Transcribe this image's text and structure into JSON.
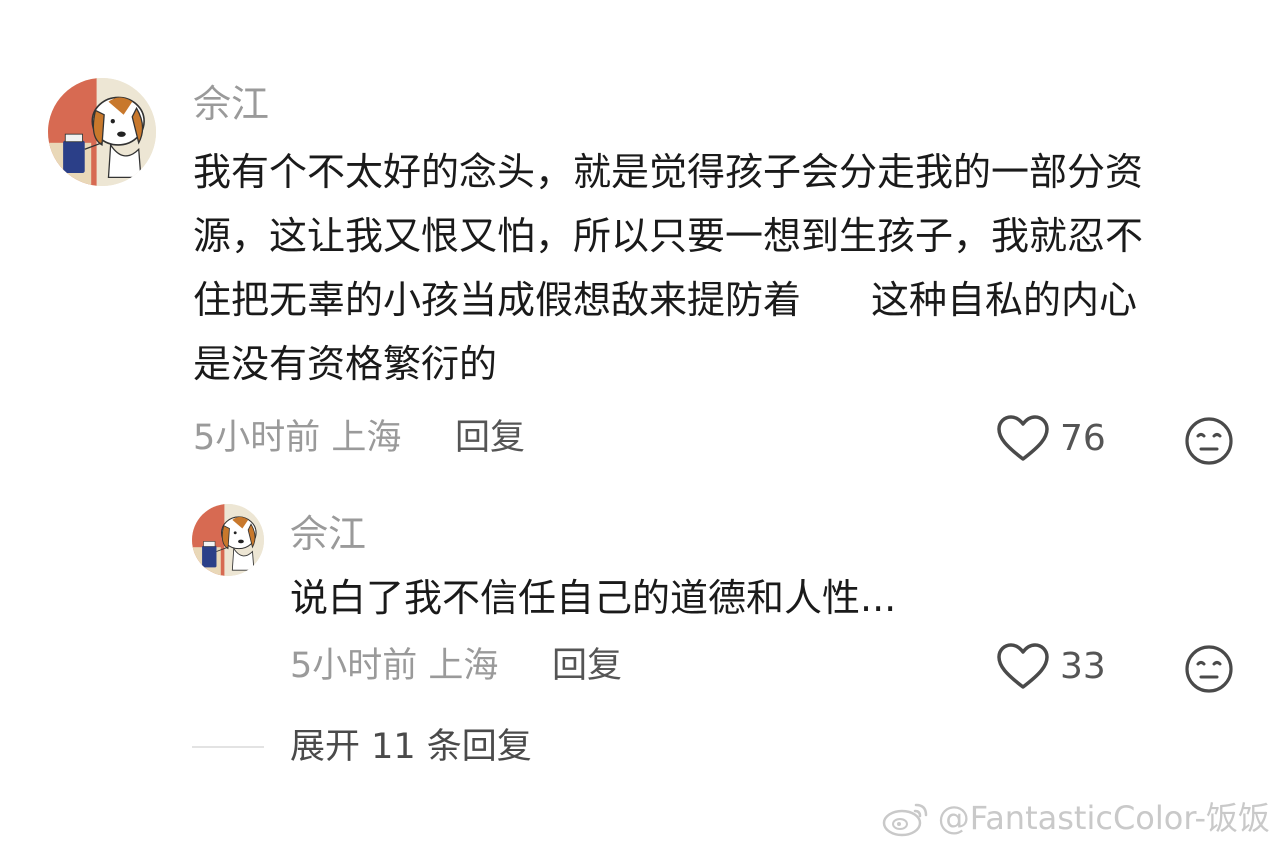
{
  "comment": {
    "username": "佘江",
    "text_lines": [
      "我有个不太好的念头，就是觉得孩子会分走我的一部分资",
      "源，这让我又恨又怕，所以只要一想到生孩子，我就忍不",
      "住把无辜的小孩当成假想敌来提防着",
      "这种自私的内心",
      "是没有资格繁衍的"
    ],
    "time": "5小时前",
    "location": "上海",
    "reply_label": "回复",
    "likes": "76"
  },
  "reply": {
    "username": "佘江",
    "text": "说白了我不信任自己的道德和人性...",
    "time": "5小时前",
    "location": "上海",
    "reply_label": "回复",
    "likes": "33"
  },
  "expand_label": "展开 11 条回复",
  "watermark": "@FantasticColor-饭饭",
  "icons": {
    "like": "heart-outline-icon",
    "dislike": "meh-face-icon",
    "watermark": "weibo-logo-icon"
  },
  "colors": {
    "username": "#9a9a9a",
    "body": "#1a1a1a",
    "meta": "#9a9a9a",
    "icon": "#4a4a4a"
  }
}
